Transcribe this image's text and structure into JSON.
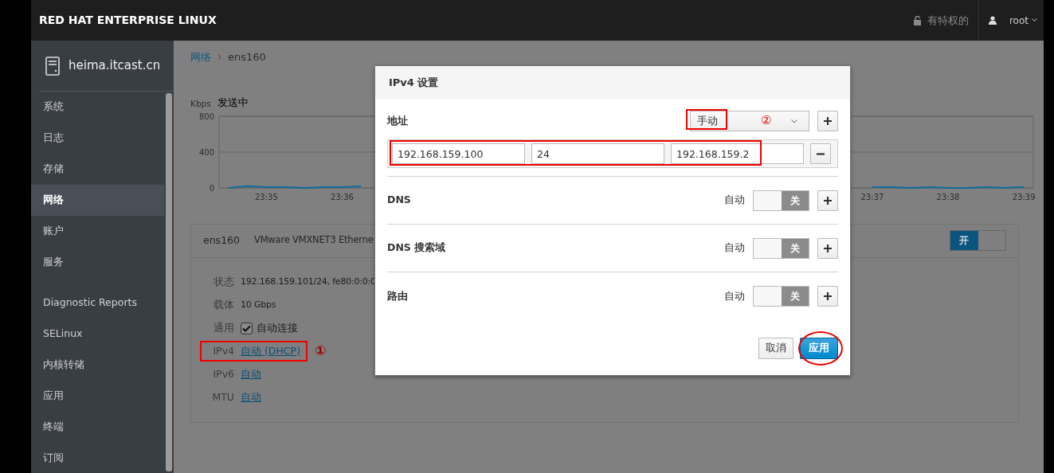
{
  "topbar": {
    "brand": "RED HAT ENTERPRISE LINUX",
    "privilege": "有特权的",
    "user": "root"
  },
  "sidebar": {
    "host": "heima.itcast.cn",
    "groups": [
      [
        {
          "label": "系统",
          "selected": false
        },
        {
          "label": "日志",
          "selected": false
        },
        {
          "label": "存储",
          "selected": false
        },
        {
          "label": "网络",
          "selected": true
        },
        {
          "label": "账户",
          "selected": false
        },
        {
          "label": "服务",
          "selected": false
        }
      ],
      [
        {
          "label": "Diagnostic Reports",
          "selected": false
        },
        {
          "label": "SELinux",
          "selected": false
        },
        {
          "label": "内核转储",
          "selected": false
        },
        {
          "label": "应用",
          "selected": false
        },
        {
          "label": "终端",
          "selected": false
        },
        {
          "label": "订阅",
          "selected": false
        }
      ]
    ]
  },
  "breadcrumb": [
    {
      "label": "网络",
      "current": false
    },
    {
      "label": "ens160",
      "current": true
    }
  ],
  "traffic": {
    "unit": "Kbps",
    "chart_data": {
      "type": "line",
      "title": "发送中",
      "categories": [
        null,
        null,
        "23:35",
        null,
        null,
        null,
        "23:36",
        null,
        null,
        null,
        null,
        null,
        null,
        null,
        null,
        null,
        null,
        null,
        null,
        null,
        null,
        null,
        null,
        null,
        null,
        null,
        null,
        null,
        null,
        null,
        null,
        null,
        null,
        null,
        "23:37",
        null,
        null,
        null,
        "23:38",
        null,
        null,
        null,
        "23:39"
      ],
      "series": [
        {
          "color": "#0f6d9a",
          "values": [
            0,
            20,
            10,
            10,
            0,
            10,
            10,
            20,
            null,
            null,
            null,
            null,
            null,
            null,
            null,
            null,
            null,
            null,
            null,
            null,
            null,
            null,
            null,
            null,
            null,
            null,
            null,
            null,
            null,
            null,
            null,
            null,
            null,
            null,
            10,
            10,
            0,
            10,
            0,
            0,
            10,
            0,
            10
          ]
        }
      ],
      "ylim": [
        0,
        800
      ],
      "yticks": [
        0,
        400,
        800
      ]
    }
  },
  "interface_card": {
    "name": "ens160",
    "description": "VMware VMXNET3 Etherne",
    "switch": {
      "label": "开",
      "on": true
    },
    "rows": [
      {
        "label": "状态",
        "value": "192.168.159.101/24, fe80:0:0:0",
        "kind": "text"
      },
      {
        "label": "载体",
        "value": "10 Gbps",
        "kind": "text"
      },
      {
        "label": "通用",
        "value": "自动连接",
        "kind": "checkbox",
        "checked": true
      },
      {
        "label": "IPv4",
        "value": "自动 (DHCP)",
        "kind": "link",
        "highlighted": true,
        "marker": "①"
      },
      {
        "label": "IPv6",
        "value": "自动",
        "kind": "link"
      },
      {
        "label": "MTU",
        "value": "自动",
        "kind": "link"
      }
    ]
  },
  "dialog": {
    "title": "IPv4 设置",
    "address": {
      "label": "地址",
      "mode": "手动",
      "mode_highlighted": true,
      "marker": "②",
      "fields": [
        "192.168.159.100",
        "24",
        "192.168.159.2"
      ],
      "fields_highlighted": true
    },
    "sections": [
      {
        "label": "DNS",
        "auto_label": "自动",
        "switch": {
          "label": "关",
          "on": false
        }
      },
      {
        "label": "DNS 搜索域",
        "auto_label": "自动",
        "switch": {
          "label": "关",
          "on": false
        }
      },
      {
        "label": "路由",
        "auto_label": "自动",
        "switch": {
          "label": "关",
          "on": false
        }
      }
    ],
    "buttons": [
      {
        "label": "取消",
        "kind": "default",
        "highlighted": false
      },
      {
        "label": "应用",
        "kind": "primary",
        "highlighted": true
      }
    ]
  }
}
